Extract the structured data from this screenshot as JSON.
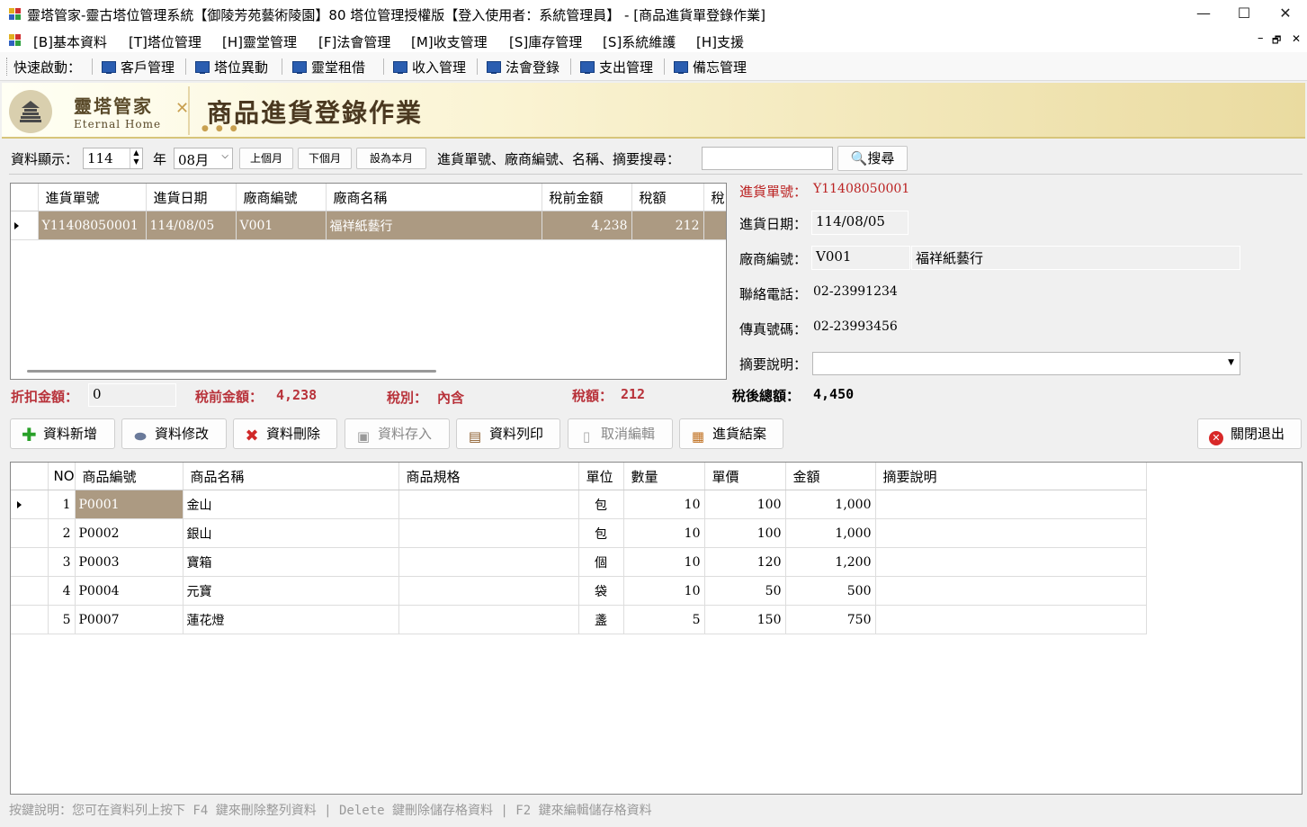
{
  "window": {
    "title": "靈塔管家-靈古塔位管理系統【御陵芳苑藝術陵園】80 塔位管理授權版【登入使用者：系統管理員】 - [商品進貨單登錄作業]",
    "minimize": "—",
    "maximize": "☐",
    "close": "✕"
  },
  "menu": {
    "items": [
      "[B]基本資料",
      "[T]塔位管理",
      "[H]靈堂管理",
      "[F]法會管理",
      "[M]收支管理",
      "[S]庫存管理",
      "[S]系統維護",
      "[H]支援"
    ],
    "mdi_min": "–",
    "mdi_restore": "🗗",
    "mdi_close": "✕"
  },
  "quickbar": {
    "label": "快速啟動：",
    "items": [
      "客戶管理",
      "塔位異動",
      "靈堂租借",
      "收入管理",
      "法會登錄",
      "支出管理",
      "備忘管理"
    ]
  },
  "banner": {
    "logo_title": "靈塔管家",
    "logo_sub": "Eternal Home",
    "title": "商品進貨登錄作業"
  },
  "filter": {
    "display_label": "資料顯示：",
    "year_value": "114",
    "year_label": "年",
    "month_value": "08月",
    "prev_month": "上個月",
    "next_month": "下個月",
    "this_month": "設為本月",
    "search_label": "進貨單號、廠商編號、名稱、摘要搜尋：",
    "search_value": "",
    "search_button": "搜尋"
  },
  "orders": {
    "columns": [
      "進貨單號",
      "進貨日期",
      "廠商編號",
      "廠商名稱",
      "稅前金額",
      "稅額",
      "稅"
    ],
    "rows": [
      {
        "no": "Y11408050001",
        "date": "114/08/05",
        "vendor_id": "V001",
        "vendor_name": "福祥紙藝行",
        "pretax": "4,238",
        "tax": "212"
      }
    ]
  },
  "detail": {
    "order_no_label": "進貨單號：",
    "order_no": "Y11408050001",
    "date_label": "進貨日期：",
    "date": "114/08/05",
    "vendor_label": "廠商編號：",
    "vendor_id": "V001",
    "vendor_name": "福祥紙藝行",
    "phone_label": "聯絡電話：",
    "phone": "02-23991234",
    "fax_label": "傳真號碼：",
    "fax": "02-23993456",
    "memo_label": "摘要說明：",
    "memo": ""
  },
  "totals": {
    "discount_label": "折扣金額：",
    "discount": "0",
    "pretax_label": "稅前金額：",
    "pretax": "4,238",
    "taxtype_label": "稅別：",
    "taxtype": "內含",
    "tax_label": "稅額：",
    "tax": "212",
    "total_label": "稅後總額：",
    "total": "4,450"
  },
  "actions": {
    "add": "資料新增",
    "edit": "資料修改",
    "delete": "資料刪除",
    "save": "資料存入",
    "print": "資料列印",
    "cancel": "取消編輯",
    "close_order": "進貨結案",
    "exit": "關閉退出"
  },
  "items": {
    "columns": [
      "NO",
      "商品編號",
      "商品名稱",
      "商品規格",
      "單位",
      "數量",
      "單價",
      "金額",
      "摘要說明"
    ],
    "rows": [
      {
        "no": "1",
        "code": "P0001",
        "name": "金山",
        "spec": "",
        "unit": "包",
        "qty": "10",
        "price": "100",
        "amount": "1,000",
        "memo": ""
      },
      {
        "no": "2",
        "code": "P0002",
        "name": "銀山",
        "spec": "",
        "unit": "包",
        "qty": "10",
        "price": "100",
        "amount": "1,000",
        "memo": ""
      },
      {
        "no": "3",
        "code": "P0003",
        "name": "寶箱",
        "spec": "",
        "unit": "個",
        "qty": "10",
        "price": "120",
        "amount": "1,200",
        "memo": ""
      },
      {
        "no": "4",
        "code": "P0004",
        "name": "元寶",
        "spec": "",
        "unit": "袋",
        "qty": "10",
        "price": "50",
        "amount": "500",
        "memo": ""
      },
      {
        "no": "5",
        "code": "P0007",
        "name": "蓮花燈",
        "spec": "",
        "unit": "盞",
        "qty": "5",
        "price": "150",
        "amount": "750",
        "memo": ""
      }
    ]
  },
  "footer": {
    "hint": "按鍵說明：您可在資料列上按下 F4 鍵來刪除整列資料 | Delete 鍵刪除儲存格資料 | F2 鍵來編輯儲存格資料"
  }
}
